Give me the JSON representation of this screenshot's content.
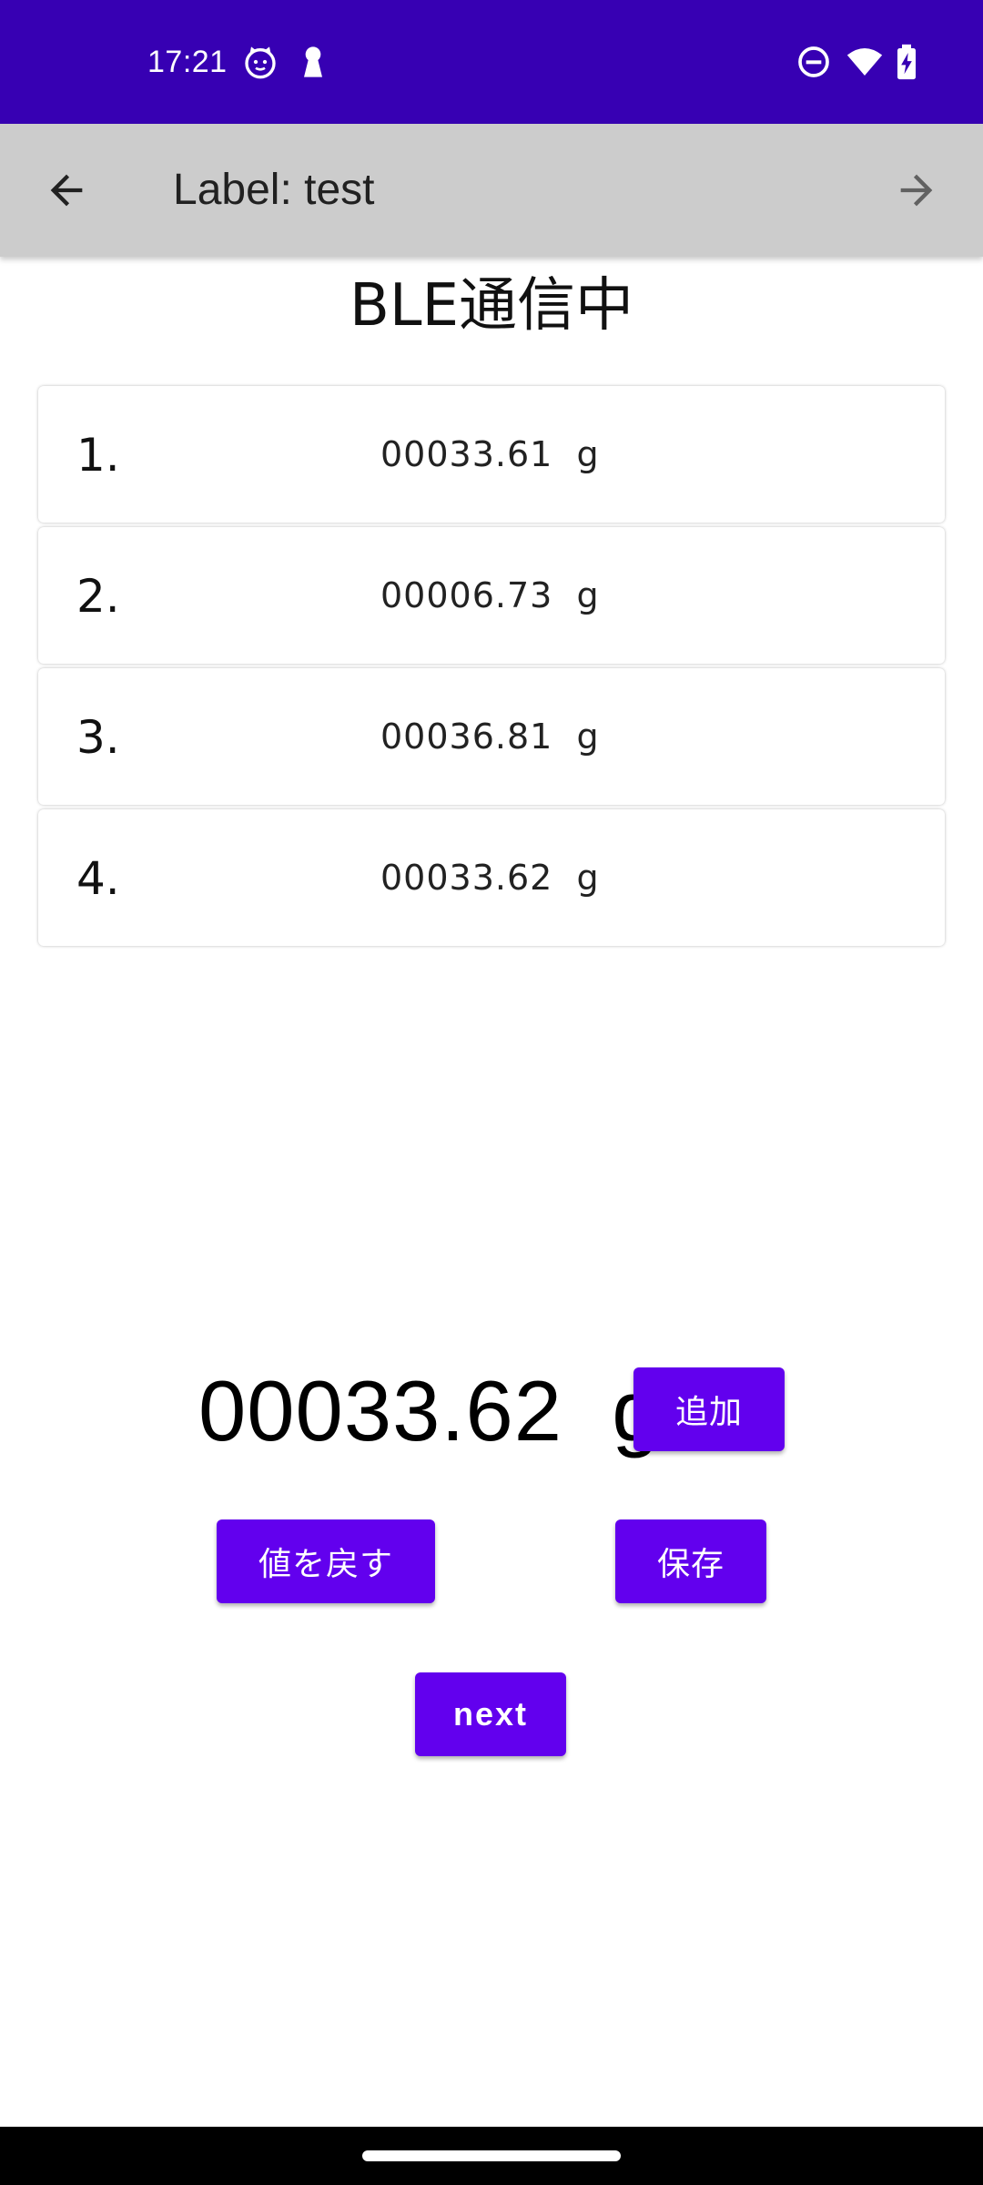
{
  "status_bar": {
    "time": "17:21",
    "icons": [
      "cat-face-icon",
      "keyhole-icon",
      "do-not-disturb-icon",
      "wifi-icon",
      "battery-charging-icon"
    ]
  },
  "app_bar": {
    "title": "Label: test",
    "back_icon": "arrow-left-icon",
    "forward_icon": "arrow-right-icon"
  },
  "page": {
    "heading": "BLE通信中"
  },
  "readings": [
    {
      "index": "1.",
      "value": "00033.61  g"
    },
    {
      "index": "2.",
      "value": "00006.73  g"
    },
    {
      "index": "3.",
      "value": "00036.81  g"
    },
    {
      "index": "4.",
      "value": "00033.62  g"
    }
  ],
  "current": {
    "value": "00033.62  g"
  },
  "buttons": {
    "add": "追加",
    "undo": "値を戻す",
    "save": "保存",
    "next": "next"
  },
  "colors": {
    "status_bar": "#3700B3",
    "app_bar": "#CCCCCC",
    "button": "#6200EE",
    "nav_bar": "#000000"
  }
}
